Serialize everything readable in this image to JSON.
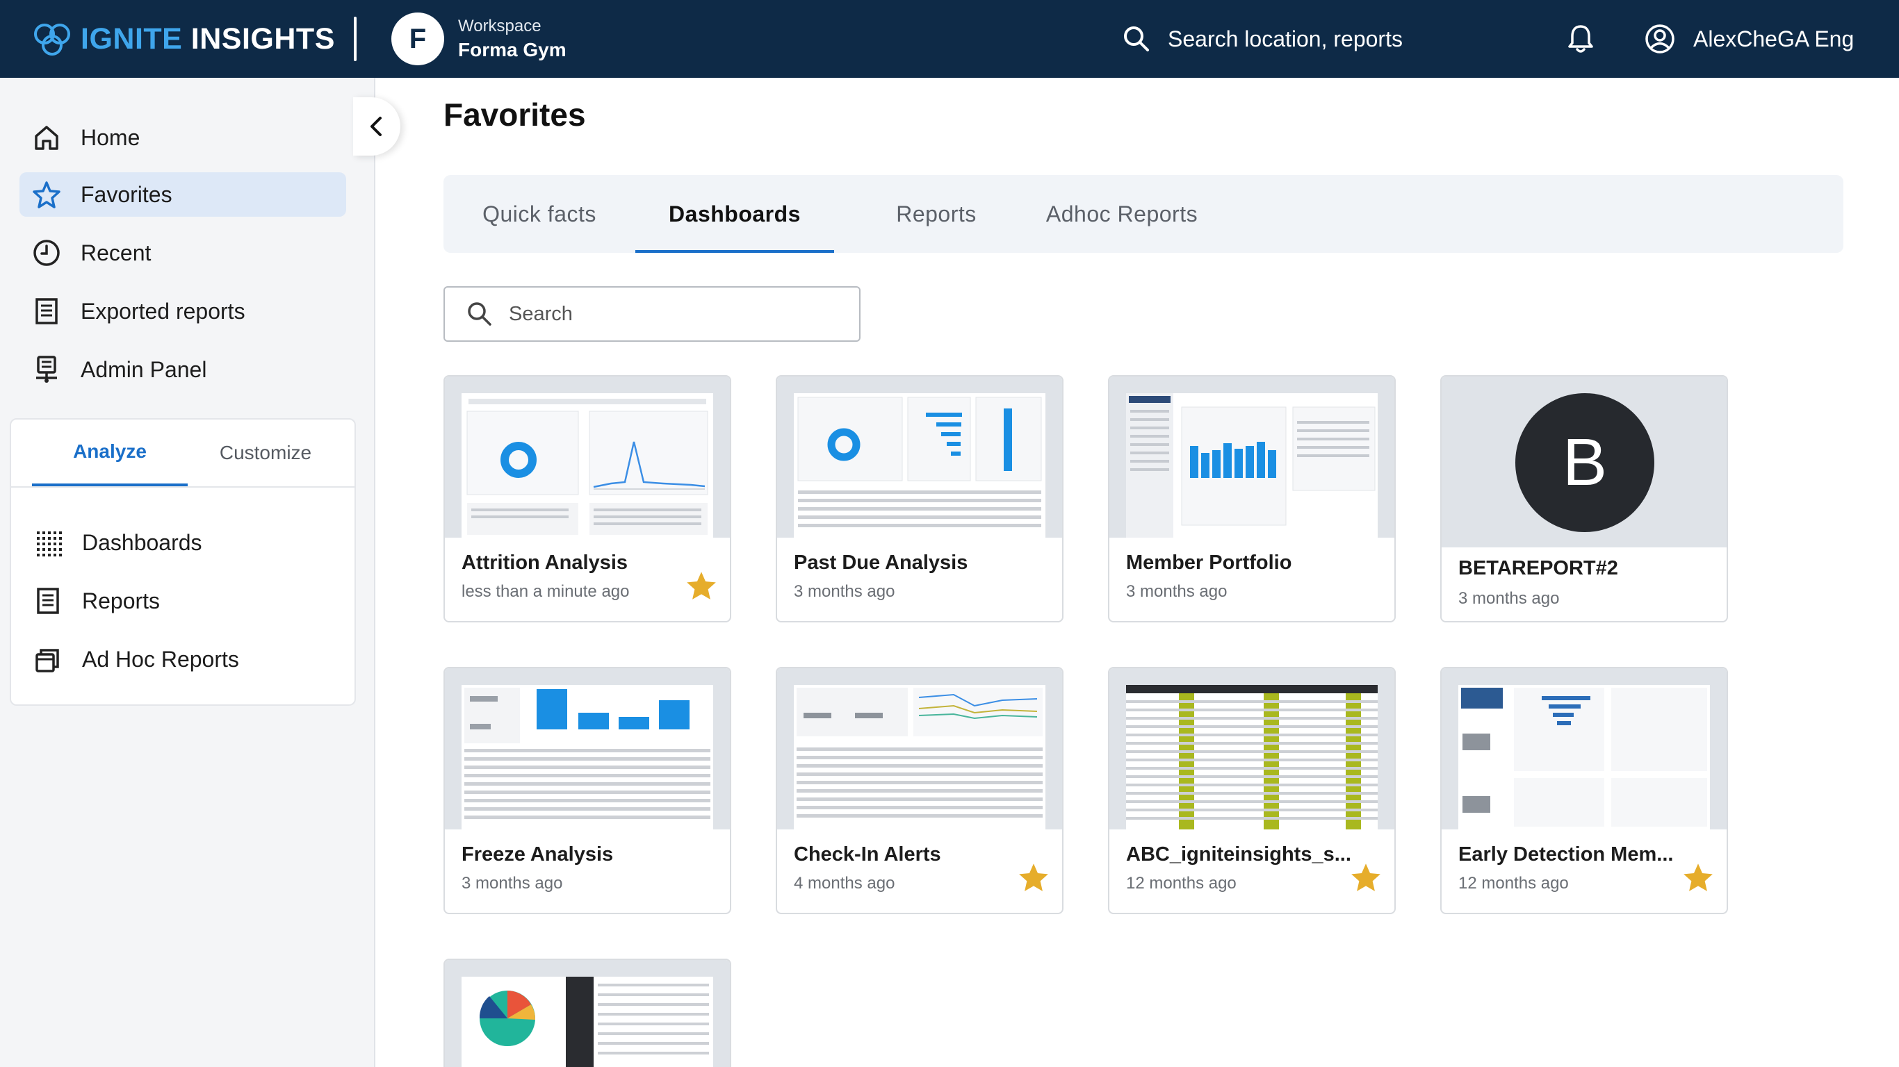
{
  "brand": {
    "part1": "IGNITE",
    "part2": "INSIGHTS"
  },
  "workspace": {
    "initial": "F",
    "label": "Workspace",
    "name": "Forma Gym"
  },
  "top_search": {
    "label": "Search location, reports"
  },
  "user": {
    "name": "AlexCheGA Eng"
  },
  "sidebar": {
    "nav": [
      {
        "label": "Home",
        "icon": "home-icon"
      },
      {
        "label": "Favorites",
        "icon": "star-outline-icon",
        "active": true
      },
      {
        "label": "Recent",
        "icon": "clock-icon"
      },
      {
        "label": "Exported reports",
        "icon": "document-list-icon"
      },
      {
        "label": "Admin Panel",
        "icon": "admin-icon"
      }
    ],
    "panel_tabs": {
      "analyze": "Analyze",
      "customize": "Customize"
    },
    "panel_items": [
      {
        "label": "Dashboards",
        "icon": "grid-dots-icon"
      },
      {
        "label": "Reports",
        "icon": "report-icon"
      },
      {
        "label": "Ad Hoc Reports",
        "icon": "adhoc-icon"
      }
    ]
  },
  "main": {
    "title": "Favorites",
    "tabs": [
      {
        "label": "Quick facts"
      },
      {
        "label": "Dashboards",
        "selected": true
      },
      {
        "label": "Reports"
      },
      {
        "label": "Adhoc Reports"
      }
    ],
    "search": {
      "placeholder": "Search"
    },
    "cards": [
      {
        "title": "Attrition Analysis",
        "subtitle": "less than a minute ago",
        "starred": true
      },
      {
        "title": "Past Due Analysis",
        "subtitle": "3 months ago",
        "starred": false
      },
      {
        "title": "Member Portfolio",
        "subtitle": "3 months ago",
        "starred": false
      },
      {
        "title": "BETAREPORT#2",
        "subtitle": "3 months ago",
        "starred": false,
        "avatar_letter": "B"
      },
      {
        "title": "Freeze Analysis",
        "subtitle": "3 months ago",
        "starred": false
      },
      {
        "title": "Check-In Alerts",
        "subtitle": "4 months ago",
        "starred": true
      },
      {
        "title": "ABC_igniteinsights_s...",
        "subtitle": "12 months ago",
        "starred": true
      },
      {
        "title": "Early Detection Mem...",
        "subtitle": "12 months ago",
        "starred": true
      }
    ]
  },
  "colors": {
    "topbar": "#0e2a47",
    "accent": "#1a6fc9",
    "star": "#e6ad2b",
    "brand_blue": "#3fa6ec"
  }
}
